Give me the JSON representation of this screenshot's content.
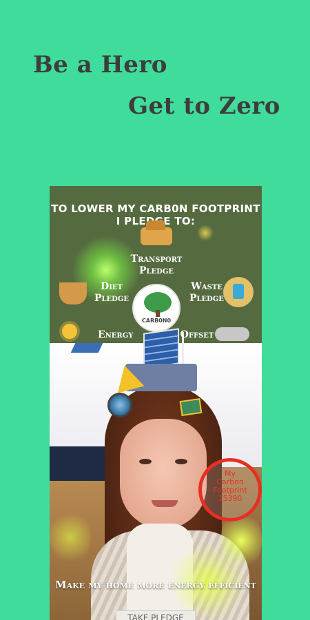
{
  "promo": {
    "headline_1": "Be a Hero",
    "headline_2": "Get to Zero"
  },
  "screen": {
    "pledge_title_line1": "TO LOWER MY CARB0N FOOTPRINT",
    "pledge_title_line2": "I PLEDGE TO:",
    "options": {
      "transport": "Transport Pledge",
      "diet": "Diet Pledge",
      "waste": "Waste Pledge",
      "energy": "Energy",
      "offset": "Offset"
    },
    "logo_text": "CARB0N0",
    "footprint": {
      "label_line1": "My",
      "label_line2": "Carbon",
      "label_line3": "Footprint",
      "value": "15390"
    },
    "tagline": "Make my home more energy efficient",
    "take_pledge_button": "TAKE PLEDGE"
  },
  "colors": {
    "background": "#3fdc9c",
    "panel": "#556b3f",
    "headline": "#3d3d3d",
    "footprint_ring": "#e63024"
  }
}
